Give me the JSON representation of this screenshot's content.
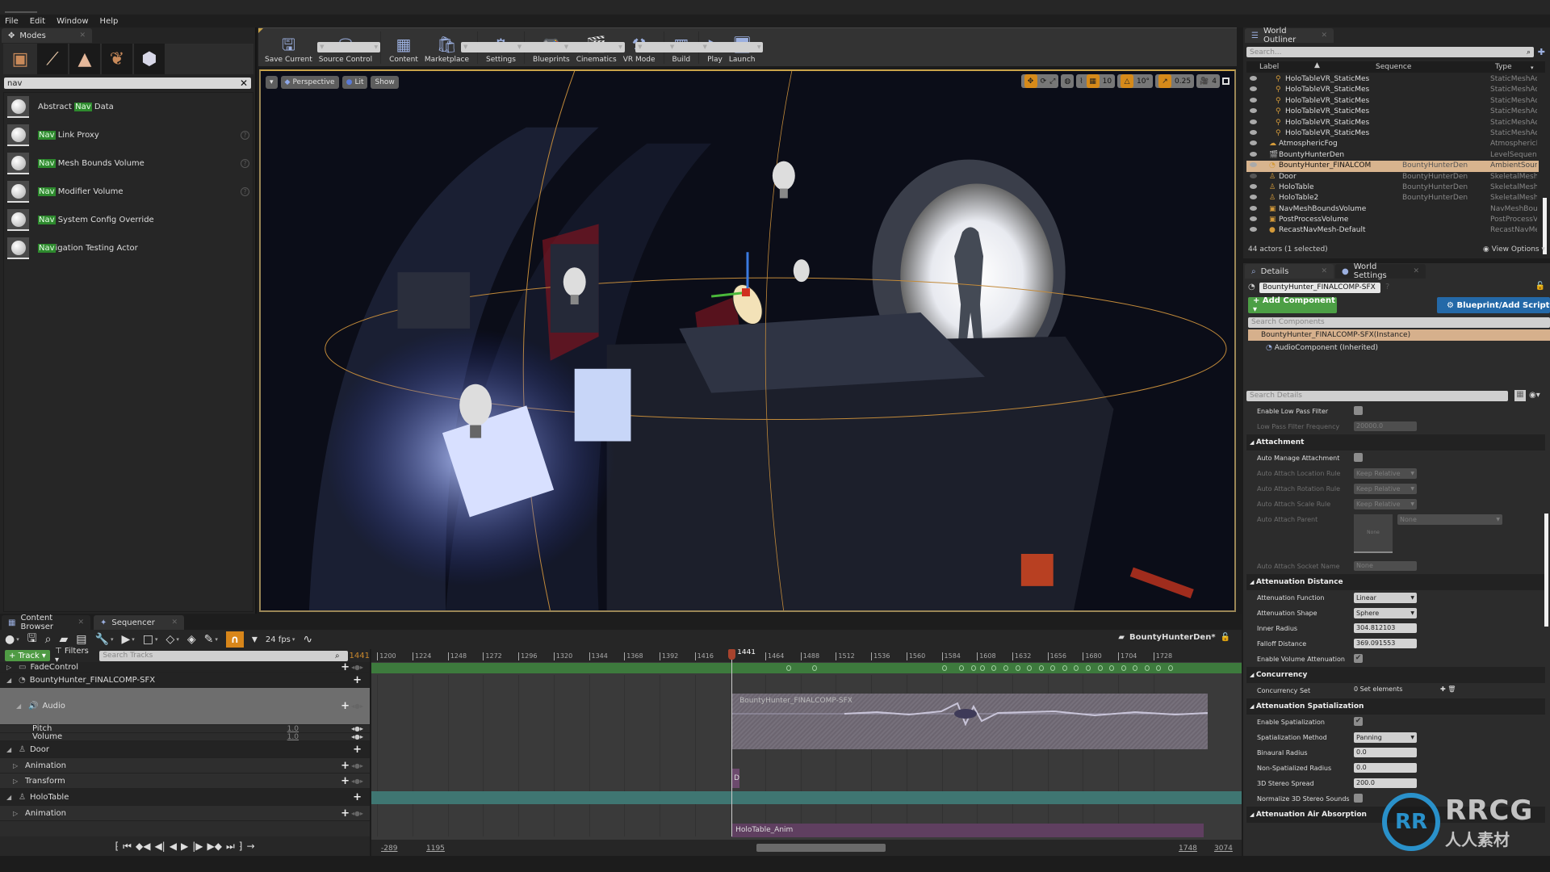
{
  "menu": [
    "File",
    "Edit",
    "Window",
    "Help"
  ],
  "modes": {
    "tab_label": "Modes",
    "tools": [
      "place-mode",
      "paint-mode",
      "landscape-mode",
      "foliage-mode",
      "geometry-mode"
    ],
    "search_value": "nav",
    "items": [
      {
        "pre": "Abstract ",
        "hl": "Nav",
        "post": " Data",
        "help": false
      },
      {
        "pre": "",
        "hl": "Nav",
        "post": " Link Proxy",
        "help": true
      },
      {
        "pre": "",
        "hl": "Nav",
        "post": " Mesh Bounds Volume",
        "help": true
      },
      {
        "pre": "",
        "hl": "Nav",
        "post": " Modifier Volume",
        "help": true
      },
      {
        "pre": "",
        "hl": "Nav",
        "post": " System Config Override",
        "help": false
      },
      {
        "pre": "",
        "hl": "Nav",
        "post": "igation Testing Actor",
        "help": false
      }
    ]
  },
  "toolbar": {
    "buttons": [
      {
        "label": "Save Current",
        "icon": "floppy-icon",
        "dropdown": false
      },
      {
        "label": "Source Control",
        "icon": "source-control-icon",
        "dropdown": true
      },
      {
        "label": "Content",
        "icon": "content-icon",
        "dropdown": false
      },
      {
        "label": "Marketplace",
        "icon": "marketplace-icon",
        "dropdown": false
      },
      {
        "label": "Settings",
        "icon": "gear-icon",
        "dropdown": true
      },
      {
        "label": "Blueprints",
        "icon": "blueprint-icon",
        "dropdown": true
      },
      {
        "label": "Cinematics",
        "icon": "clapperboard-icon",
        "dropdown": true
      },
      {
        "label": "VR Mode",
        "icon": "vr-icon",
        "dropdown": false
      },
      {
        "label": "Build",
        "icon": "build-icon",
        "dropdown": true
      },
      {
        "label": "Play",
        "icon": "play-icon",
        "dropdown": true
      },
      {
        "label": "Launch",
        "icon": "launch-icon",
        "dropdown": true
      }
    ]
  },
  "viewport": {
    "perspective": "Perspective",
    "lit": "Lit",
    "show": "Show",
    "grid_snap": "10",
    "rotation_snap": "10°",
    "scale_snap": "0.25",
    "camera_speed": "4"
  },
  "bottom_tabs": [
    "Content Browser",
    "Sequencer"
  ],
  "sequencer": {
    "fps": "24 fps",
    "sequence_name": "BountyHunterDen*",
    "add_track": "Track",
    "filters": "Filters",
    "search_placeholder": "Search Tracks",
    "current_frame": "1441",
    "tracks": [
      {
        "name": "FadeControl",
        "level": 0,
        "type": "header",
        "expand": "▷"
      },
      {
        "name": "BountyHunter_FINALCOMP-SFX",
        "level": 0,
        "type": "header",
        "expand": "◢"
      },
      {
        "name": "Audio",
        "level": 1,
        "type": "audio",
        "expand": "◢"
      },
      {
        "name": "Pitch",
        "level": 2,
        "type": "param",
        "value": "1.0"
      },
      {
        "name": "Volume",
        "level": 2,
        "type": "param",
        "value": "1.0"
      },
      {
        "name": "Door",
        "level": 0,
        "type": "header",
        "expand": "◢"
      },
      {
        "name": "Animation",
        "level": 1,
        "type": "sub",
        "expand": "▷"
      },
      {
        "name": "Transform",
        "level": 1,
        "type": "sub",
        "expand": "▷"
      },
      {
        "name": "HoloTable",
        "level": 0,
        "type": "header",
        "expand": "◢"
      },
      {
        "name": "Animation",
        "level": 1,
        "type": "sub",
        "expand": "▷"
      }
    ],
    "ruler_ticks": [
      "1200",
      "1224",
      "1248",
      "1272",
      "1296",
      "1320",
      "1344",
      "1368",
      "1392",
      "1416",
      "1464",
      "1488",
      "1512",
      "1536",
      "1560",
      "1584",
      "1608",
      "1632",
      "1656",
      "1680",
      "1704",
      "1728"
    ],
    "audio_section_label": "BountyHunter_FINALCOMP-SFX",
    "door_anim_label": "D",
    "holo_anim_label": "HoloTable_Anim",
    "view_range_start": "-289",
    "working_start": "1195",
    "working_end": "1748",
    "view_range_end": "3074",
    "transport": [
      "⁅",
      "⏮",
      "◆◀",
      "◀|",
      "◀",
      "▶",
      "|▶",
      "▶◆",
      "⏭",
      "⁆",
      "→"
    ]
  },
  "outliner": {
    "tab_label": "World Outliner",
    "search_placeholder": "Search...",
    "columns": [
      "Label",
      "Sequence",
      "Type"
    ],
    "rows": [
      {
        "label": "HoloTableVR_StaticMes",
        "sequence": "",
        "type": "StaticMeshAct",
        "indent": 2,
        "selected": false
      },
      {
        "label": "HoloTableVR_StaticMes",
        "sequence": "",
        "type": "StaticMeshAct",
        "indent": 2,
        "selected": false
      },
      {
        "label": "HoloTableVR_StaticMes",
        "sequence": "",
        "type": "StaticMeshAct",
        "indent": 2,
        "selected": false
      },
      {
        "label": "HoloTableVR_StaticMes",
        "sequence": "",
        "type": "StaticMeshAct",
        "indent": 2,
        "selected": false
      },
      {
        "label": "HoloTableVR_StaticMes",
        "sequence": "",
        "type": "StaticMeshAct",
        "indent": 2,
        "selected": false
      },
      {
        "label": "HoloTableVR_StaticMes",
        "sequence": "",
        "type": "StaticMeshAct",
        "indent": 2,
        "selected": false
      },
      {
        "label": "AtmosphericFog",
        "sequence": "",
        "type": "AtmosphericFog",
        "indent": 1,
        "selected": false
      },
      {
        "label": "BountyHunterDen",
        "sequence": "",
        "type": "LevelSequence",
        "indent": 1,
        "selected": false
      },
      {
        "label": "BountyHunter_FINALCOM",
        "sequence": "BountyHunterDen",
        "type": "AmbientSound",
        "indent": 1,
        "selected": true
      },
      {
        "label": "Door",
        "sequence": "BountyHunterDen",
        "type": "SkeletalMeshA",
        "indent": 1,
        "selected": false
      },
      {
        "label": "HoloTable",
        "sequence": "BountyHunterDen",
        "type": "SkeletalMeshA",
        "indent": 1,
        "selected": false
      },
      {
        "label": "HoloTable2",
        "sequence": "BountyHunterDen",
        "type": "SkeletalMeshA",
        "indent": 1,
        "selected": false
      },
      {
        "label": "NavMeshBoundsVolume",
        "sequence": "",
        "type": "NavMeshBoun",
        "indent": 1,
        "selected": false
      },
      {
        "label": "PostProcessVolume",
        "sequence": "",
        "type": "PostProcessV",
        "indent": 1,
        "selected": false
      },
      {
        "label": "RecastNavMesh-Default",
        "sequence": "",
        "type": "RecastNavMes",
        "indent": 1,
        "selected": false
      }
    ],
    "actor_count": "44 actors (1 selected)",
    "view_options": "View Options"
  },
  "details": {
    "tabs": [
      "Details",
      "World Settings"
    ],
    "actor_name": "BountyHunter_FINALCOMP-SFX",
    "add_component": "+ Add Component ▾",
    "blueprint_script": "Blueprint/Add Script",
    "component_search_placeholder": "Search Components",
    "instance_label": "BountyHunter_FINALCOMP-SFX(Instance)",
    "audio_component": "AudioComponent (Inherited)",
    "search_details_placeholder": "Search Details",
    "properties": [
      {
        "kind": "row",
        "label": "Enable Low Pass Filter",
        "control": "check",
        "value": ""
      },
      {
        "kind": "row",
        "label": "Low Pass Filter Frequency",
        "control": "field",
        "value": "20000.0",
        "dim": true
      },
      {
        "kind": "cat",
        "label": "Attachment"
      },
      {
        "kind": "row",
        "label": "Auto Manage Attachment",
        "control": "check",
        "value": ""
      },
      {
        "kind": "row",
        "label": "Auto Attach Location Rule",
        "control": "dropdown",
        "value": "Keep Relative",
        "dim": true
      },
      {
        "kind": "row",
        "label": "Auto Attach Rotation Rule",
        "control": "dropdown",
        "value": "Keep Relative",
        "dim": true
      },
      {
        "kind": "row",
        "label": "Auto Attach Scale Rule",
        "control": "dropdown",
        "value": "Keep Relative",
        "dim": true
      },
      {
        "kind": "tall",
        "label": "Auto Attach Parent",
        "control": "asset",
        "value": "None",
        "dim": true
      },
      {
        "kind": "row",
        "label": "Auto Attach Socket Name",
        "control": "field",
        "value": "None",
        "dim": true
      },
      {
        "kind": "cat",
        "label": "Attenuation Distance"
      },
      {
        "kind": "row",
        "label": "Attenuation Function",
        "control": "dropdown",
        "value": "Linear"
      },
      {
        "kind": "row",
        "label": "Attenuation Shape",
        "control": "dropdown",
        "value": "Sphere"
      },
      {
        "kind": "row",
        "label": "Inner Radius",
        "control": "field",
        "value": "304.812103"
      },
      {
        "kind": "row",
        "label": "Falloff Distance",
        "control": "field",
        "value": "369.091553"
      },
      {
        "kind": "row",
        "label": "Enable Volume Attenuation",
        "control": "check",
        "value": "✔"
      },
      {
        "kind": "cat",
        "label": "Concurrency"
      },
      {
        "kind": "row",
        "label": "Concurrency Set",
        "control": "text",
        "value": "0 Set elements"
      },
      {
        "kind": "cat",
        "label": "Attenuation Spatialization"
      },
      {
        "kind": "row",
        "label": "Enable Spatialization",
        "control": "check",
        "value": "✔"
      },
      {
        "kind": "row",
        "label": "Spatialization Method",
        "control": "dropdown",
        "value": "Panning"
      },
      {
        "kind": "row",
        "label": "Binaural Radius",
        "control": "field",
        "value": "0.0"
      },
      {
        "kind": "row",
        "label": "Non-Spatialized Radius",
        "control": "field",
        "value": "0.0"
      },
      {
        "kind": "row",
        "label": "3D Stereo Spread",
        "control": "field",
        "value": "200.0"
      },
      {
        "kind": "row",
        "label": "Normalize 3D Stereo Sounds",
        "control": "check",
        "value": ""
      },
      {
        "kind": "cat",
        "label": "Attenuation Air Absorption"
      }
    ]
  },
  "watermark": {
    "logo": "RR",
    "line1": "RRCG",
    "line2": "人人素材"
  },
  "colors": {
    "accent_orange": "#d8861a",
    "selection": "#d8b48e",
    "add_green": "#4c9f45",
    "blueprint_blue": "#2469a8",
    "timeline_green": "#3d7a3d",
    "playhead": "#a8432d"
  }
}
